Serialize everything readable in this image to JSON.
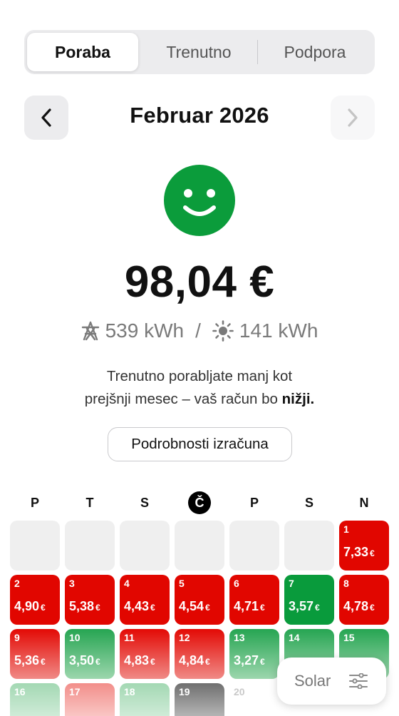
{
  "tabs": [
    {
      "label": "Poraba",
      "active": true
    },
    {
      "label": "Trenutno",
      "active": false
    },
    {
      "label": "Podpora",
      "active": false
    }
  ],
  "period": {
    "month_label": "Februar 2026",
    "prev_icon": "chevron-left-icon",
    "next_icon": "chevron-right-icon",
    "next_enabled": false
  },
  "summary": {
    "status_icon": "smiley-face-icon",
    "status_color": "#0b9c3b",
    "amount": "98,04 €",
    "grid_icon": "power-tower-icon",
    "grid_kwh": "539 kWh",
    "separator": "/",
    "solar_icon": "sun-icon",
    "solar_kwh": "141 kWh",
    "message_line1": "Trenutno porabljate manj kot",
    "message_line2_prefix": "prejšnji mesec – vaš račun bo ",
    "message_line2_bold": "nižji.",
    "details_button": "Podrobnosti izračuna"
  },
  "calendar": {
    "weekdays": [
      "P",
      "T",
      "S",
      "Č",
      "P",
      "S",
      "N"
    ],
    "today_weekday_index": 3,
    "currency": "€",
    "colors": {
      "high": "#e10600",
      "low": "#099b3c"
    },
    "days": [
      {
        "day": "1",
        "value": "7,33",
        "status": "high"
      },
      {
        "day": "2",
        "value": "4,90",
        "status": "high"
      },
      {
        "day": "3",
        "value": "5,38",
        "status": "high"
      },
      {
        "day": "4",
        "value": "4,43",
        "status": "high"
      },
      {
        "day": "5",
        "value": "4,54",
        "status": "high"
      },
      {
        "day": "6",
        "value": "4,71",
        "status": "high"
      },
      {
        "day": "7",
        "value": "3,57",
        "status": "low"
      },
      {
        "day": "8",
        "value": "4,78",
        "status": "high"
      },
      {
        "day": "9",
        "value": "5,36",
        "status": "high"
      },
      {
        "day": "10",
        "value": "3,50",
        "status": "low"
      },
      {
        "day": "11",
        "value": "4,83",
        "status": "high"
      },
      {
        "day": "12",
        "value": "4,84",
        "status": "high"
      },
      {
        "day": "13",
        "value": "3,27",
        "status": "low"
      },
      {
        "day": "14",
        "value": "",
        "status": "low"
      },
      {
        "day": "15",
        "value": "",
        "status": "low"
      },
      {
        "day": "16",
        "value": "",
        "status": "low"
      },
      {
        "day": "17",
        "value": "",
        "status": "high"
      },
      {
        "day": "18",
        "value": "",
        "status": "low"
      },
      {
        "day": "19",
        "value": "",
        "status": "today"
      },
      {
        "day": "20",
        "value": "",
        "status": "future"
      }
    ]
  },
  "solar_button": {
    "label": "Solar",
    "icon": "sliders-icon"
  }
}
